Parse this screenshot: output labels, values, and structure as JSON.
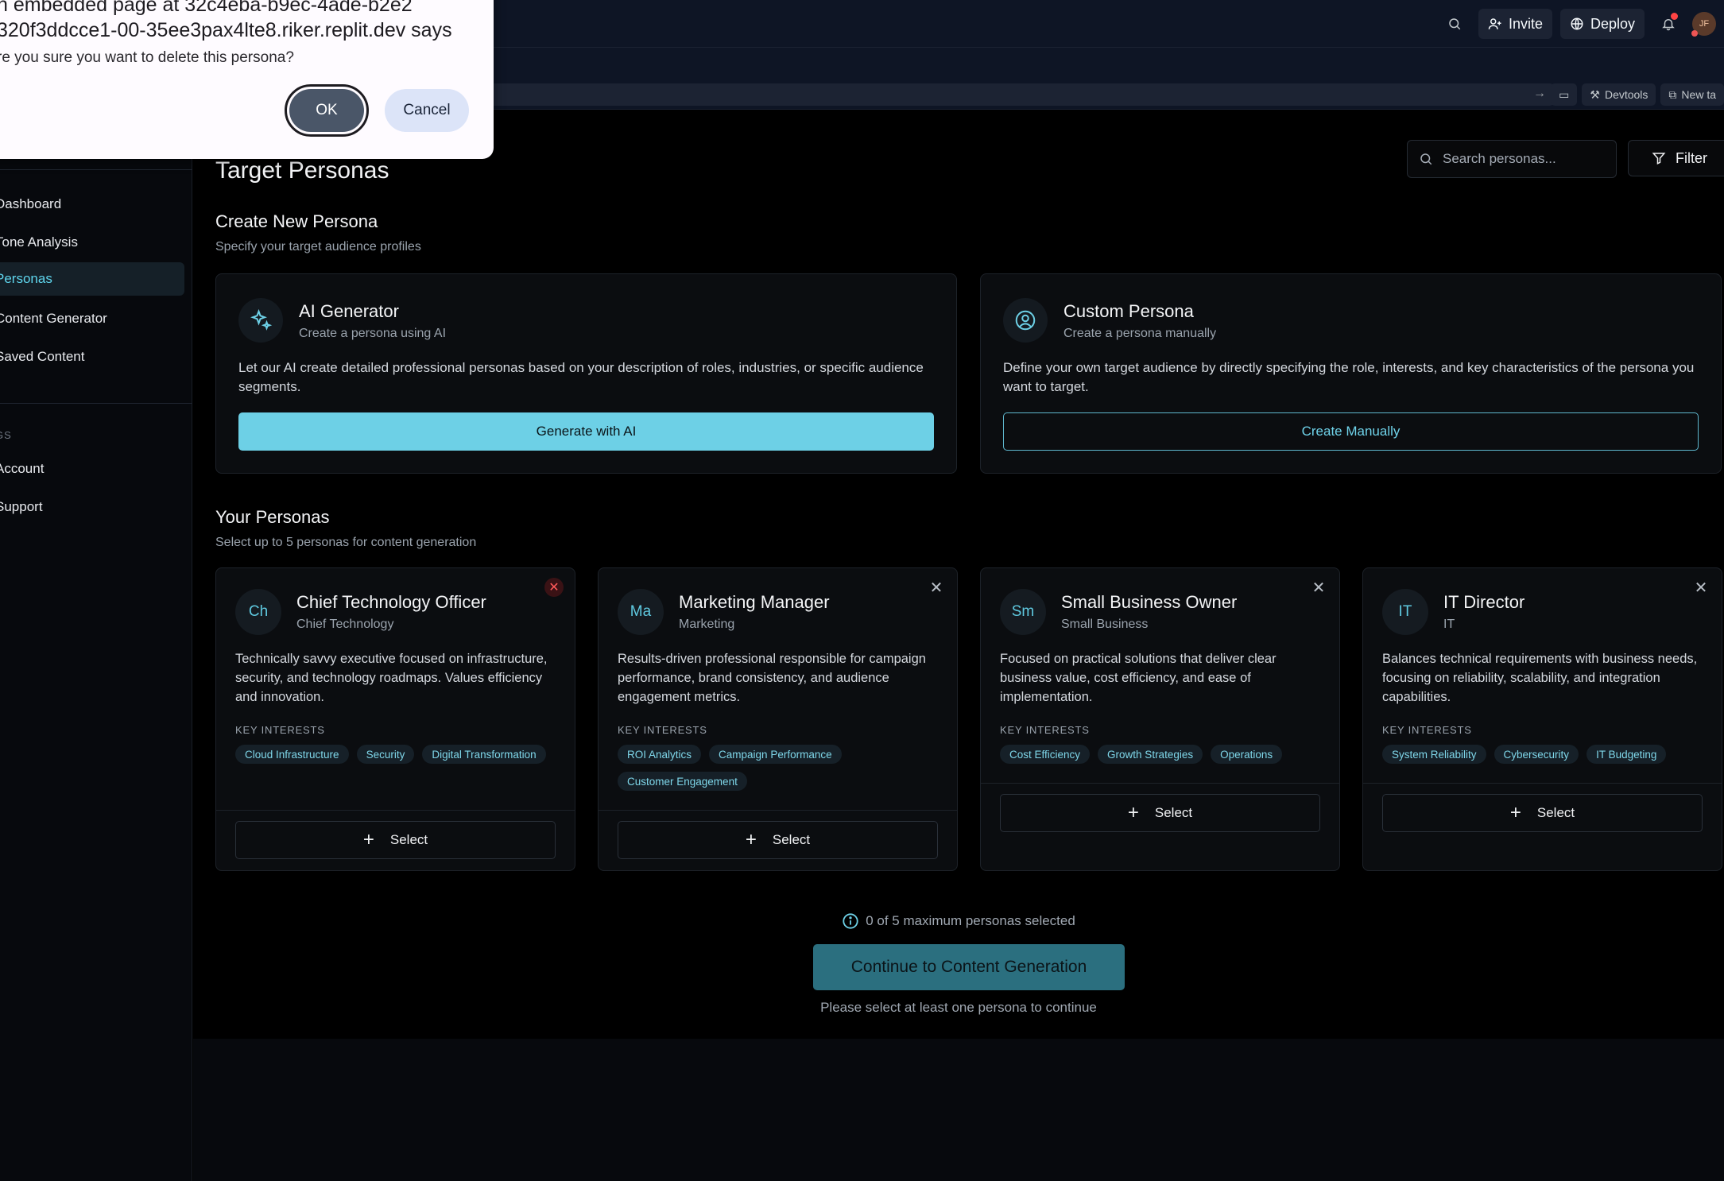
{
  "topbar": {
    "invite_label": "Invite",
    "deploy_label": "Deploy",
    "avatar_initials": "JF"
  },
  "urlbar": {
    "devtools_label": "Devtools",
    "newtab_label": "New ta"
  },
  "dialog": {
    "line1": "n embedded page at 32c4eba-b9ec-4ade-b2e2",
    "line2": "320f3ddcce1-00-35ee3pax4lte8.riker.replit.dev says",
    "message": "re you sure you want to delete this persona?",
    "ok_label": "OK",
    "cancel_label": "Cancel"
  },
  "sidebar": {
    "items": [
      {
        "label": "Dashboard"
      },
      {
        "label": "Tone Analysis"
      },
      {
        "label": "Personas"
      },
      {
        "label": "Content Generator"
      },
      {
        "label": "Saved Content"
      }
    ],
    "section_label": "GS",
    "settings_items": [
      {
        "label": "Account"
      },
      {
        "label": "Support"
      }
    ]
  },
  "header": {
    "title": "Target Personas",
    "search_placeholder": "Search personas...",
    "filter_label": "Filter"
  },
  "create": {
    "title": "Create New Persona",
    "subtitle": "Specify your target audience profiles",
    "ai": {
      "title": "AI Generator",
      "subtitle": "Create a persona using AI",
      "description": "Let our AI create detailed professional personas based on your description of roles, industries, or specific audience segments.",
      "button": "Generate with AI"
    },
    "custom": {
      "title": "Custom Persona",
      "subtitle": "Create a persona manually",
      "description": "Define your own target audience by directly specifying the role, interests, and key characteristics of the persona you want to target.",
      "button": "Create Manually"
    }
  },
  "personas": {
    "title": "Your Personas",
    "subtitle": "Select up to 5 personas for content generation",
    "key_interests_label": "KEY INTERESTS",
    "select_label": "Select",
    "cards": [
      {
        "initials": "Ch",
        "name": "Chief Technology Officer",
        "industry": "Chief Technology",
        "description": "Technically savvy executive focused on infrastructure, security, and technology roadmaps. Values efficiency and innovation.",
        "tags": [
          "Cloud Infrastructure",
          "Security",
          "Digital Transformation"
        ]
      },
      {
        "initials": "Ma",
        "name": "Marketing Manager",
        "industry": "Marketing",
        "description": "Results-driven professional responsible for campaign performance, brand consistency, and audience engagement metrics.",
        "tags": [
          "ROI Analytics",
          "Campaign Performance",
          "Customer Engagement"
        ]
      },
      {
        "initials": "Sm",
        "name": "Small Business Owner",
        "industry": "Small Business",
        "description": "Focused on practical solutions that deliver clear business value, cost efficiency, and ease of implementation.",
        "tags": [
          "Cost Efficiency",
          "Growth Strategies",
          "Operations"
        ]
      },
      {
        "initials": "IT",
        "name": "IT Director",
        "industry": "IT",
        "description": "Balances technical requirements with business needs, focusing on reliability, scalability, and integration capabilities.",
        "tags": [
          "System Reliability",
          "Cybersecurity",
          "IT Budgeting"
        ]
      }
    ],
    "selection_status": "0 of 5 maximum personas selected",
    "continue_label": "Continue to Content Generation",
    "helper_text": "Please select at least one persona to continue"
  },
  "colors": {
    "accent": "#6dd0e6",
    "background": "#000000",
    "card": "#0b0d10",
    "danger": "#ff5a5a"
  }
}
